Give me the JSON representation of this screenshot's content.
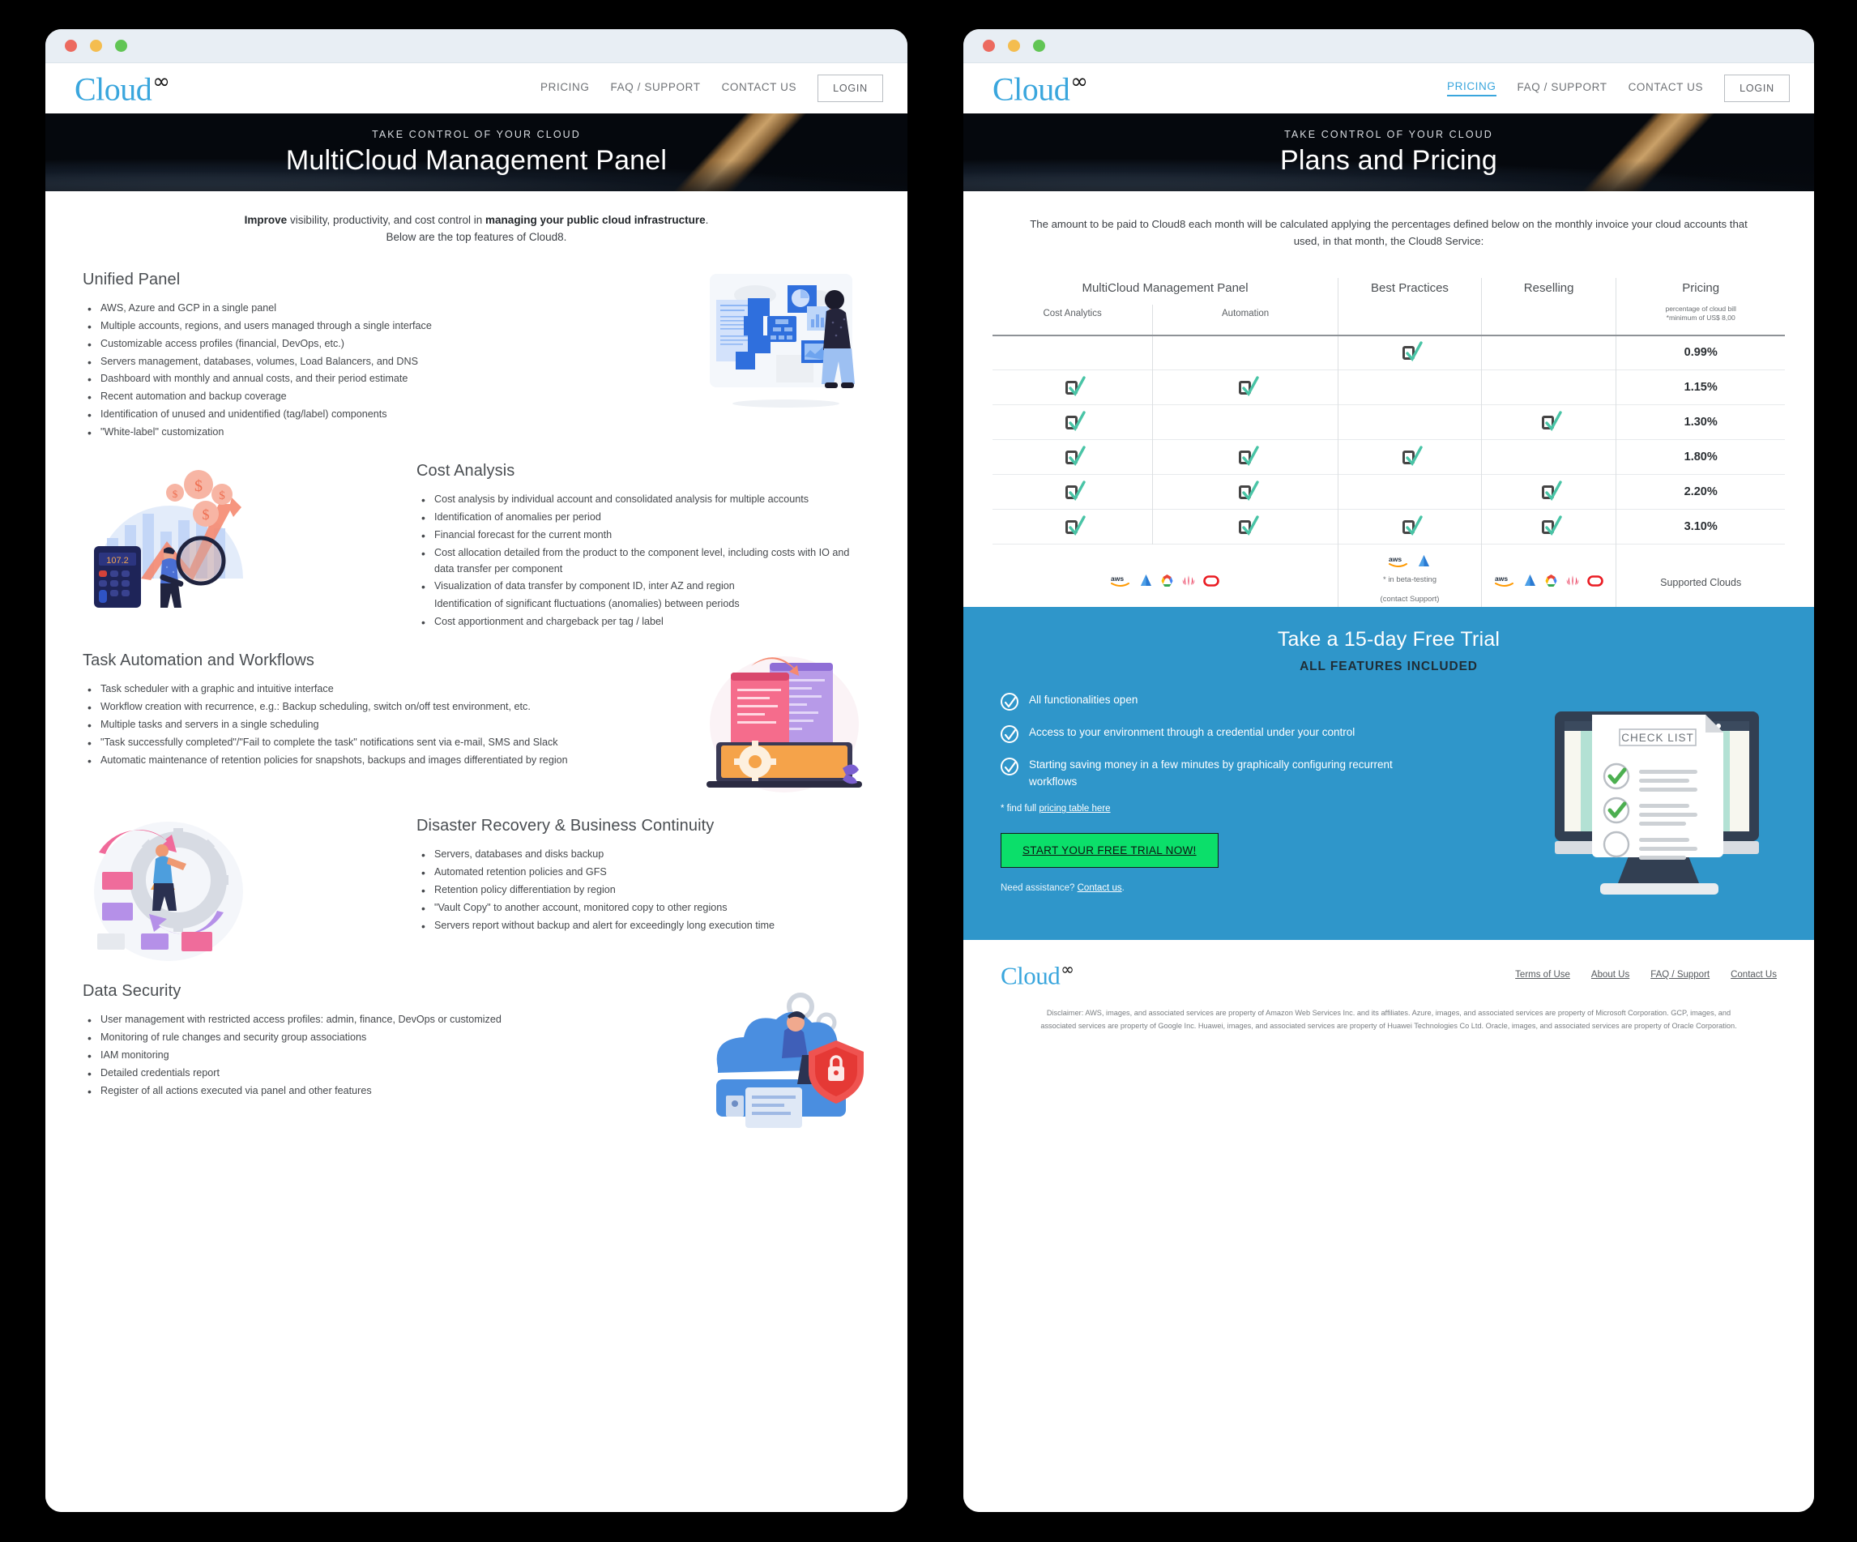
{
  "brand": {
    "name": "Cloud",
    "mark": "∞"
  },
  "window_left": {
    "nav": {
      "items": [
        "PRICING",
        "FAQ / SUPPORT",
        "CONTACT US"
      ],
      "active": null,
      "login": "LOGIN"
    },
    "hero": {
      "kicker": "TAKE CONTROL OF YOUR CLOUD",
      "title": "MultiCloud Management Panel"
    },
    "intro": {
      "line1_bold_start": "Improve",
      "line1_mid": " visibility, productivity, and cost control in ",
      "line1_bold_end": "managing your public cloud infrastructure",
      "line1_tail": ".",
      "line2": "Below are the top features of Cloud8."
    },
    "features": [
      {
        "title": "Unified Panel",
        "art": "unified-panel-illustration",
        "items": [
          "AWS, Azure and GCP in a single panel",
          "Multiple accounts, regions, and users managed through a single interface",
          "Customizable access profiles (financial, DevOps, etc.)",
          "Servers management, databases, volumes, Load Balancers, and DNS",
          "Dashboard with monthly and annual costs, and their period estimate",
          "Recent automation and backup coverage",
          "Identification of unused and unidentified (tag/label) components",
          "\"White-label\" customization"
        ]
      },
      {
        "title": "Cost Analysis",
        "art": "cost-analysis-illustration",
        "items": [
          "Cost analysis by individual account and consolidated analysis for multiple accounts",
          "Identification of anomalies per period",
          "Financial forecast for the current month",
          "Cost allocation detailed from the product to the component level, including costs with IO and data transfer per component",
          "Visualization of data transfer by component ID, inter AZ and region",
          "Identification of significant fluctuations (anomalies) between periods",
          "Cost apportionment and chargeback per tag / label"
        ],
        "no_bullet_indexes": [
          5
        ]
      },
      {
        "title": "Task Automation and Workflows",
        "art": "task-automation-illustration",
        "items": [
          "Task scheduler with a graphic and intuitive interface",
          "Workflow creation with recurrence, e.g.: Backup scheduling, switch on/off test environment, etc.",
          "Multiple tasks and servers in a single scheduling",
          "\"Task successfully completed\"/\"Fail to complete the task\" notifications sent via e-mail, SMS and Slack",
          "Automatic maintenance of retention policies for snapshots, backups and images differentiated by region"
        ]
      },
      {
        "title": "Disaster Recovery & Business Continuity",
        "art": "disaster-recovery-illustration",
        "items": [
          "Servers, databases and disks backup",
          "Automated retention policies and GFS",
          "Retention policy differentiation by region",
          "\"Vault Copy\" to another account, monitored copy to other regions",
          "Servers report without backup and alert for exceedingly long execution time"
        ]
      },
      {
        "title": "Data Security",
        "art": "data-security-illustration",
        "items": [
          "User management with restricted access profiles: admin, finance, DevOps or customized",
          "Monitoring of rule changes and security group associations",
          "IAM monitoring",
          "Detailed credentials report",
          "Register of all actions executed via panel and other features"
        ]
      }
    ]
  },
  "window_right": {
    "nav": {
      "items": [
        "PRICING",
        "FAQ / SUPPORT",
        "CONTACT US"
      ],
      "active": "PRICING",
      "login": "LOGIN"
    },
    "hero": {
      "kicker": "TAKE CONTROL OF YOUR CLOUD",
      "title": "Plans and Pricing"
    },
    "intro": "The amount to be paid to Cloud8 each month will be calculated applying the percentages defined below on the monthly invoice your cloud accounts that used, in that month, the Cloud8 Service:",
    "table": {
      "group_headers": [
        "MultiCloud Management Panel",
        "Best Practices",
        "Reselling",
        "Pricing"
      ],
      "sub_headers": [
        "Cost Analytics",
        "Automation",
        "",
        "",
        "percentage of cloud bill\n*minimum of US$ 8,00"
      ],
      "columns": [
        "Cost Analytics",
        "Automation",
        "Best Practices",
        "Reselling",
        "Pricing"
      ],
      "rows": [
        {
          "checks": [
            false,
            false,
            true,
            false
          ],
          "price": "0.99%"
        },
        {
          "checks": [
            true,
            true,
            false,
            false
          ],
          "price": "1.15%"
        },
        {
          "checks": [
            true,
            false,
            false,
            true
          ],
          "price": "1.30%"
        },
        {
          "checks": [
            true,
            true,
            true,
            false
          ],
          "price": "1.80%"
        },
        {
          "checks": [
            true,
            true,
            false,
            true
          ],
          "price": "2.20%"
        },
        {
          "checks": [
            true,
            true,
            true,
            true
          ],
          "price": "3.10%"
        }
      ],
      "supported_row": {
        "multicloud_clouds": [
          "aws",
          "azure",
          "gcp",
          "huawei",
          "oracle"
        ],
        "best_practices_clouds": [
          "aws",
          "azure"
        ],
        "best_practices_note_1": "* in beta-testing",
        "best_practices_note_2": "(contact Support)",
        "reselling_clouds": [
          "aws",
          "azure",
          "gcp",
          "huawei",
          "oracle"
        ],
        "label": "Supported Clouds"
      }
    },
    "trial": {
      "title": "Take a 15-day Free Trial",
      "subtitle": "ALL FEATURES INCLUDED",
      "bullets": [
        "All functionalities open",
        "Access to your environment through a credential under your control",
        "Starting saving money in a few minutes by graphically configuring recurrent workflows"
      ],
      "find_full_prefix": "* find full ",
      "find_full_link": "pricing table here",
      "cta": "START YOUR FREE TRIAL NOW!",
      "assistance_prefix": "Need assistance? ",
      "assistance_link": "Contact us",
      "assistance_suffix": ".",
      "art_label": "CHECK LIST",
      "bg_color": "#2f96ca",
      "cta_color": "#0bdf6a"
    },
    "footer": {
      "links": [
        "Terms of Use",
        "About Us",
        "FAQ / Support",
        "Contact Us"
      ],
      "disclaimer": "Disclaimer: AWS, images, and associated services are property of Amazon Web Services Inc. and its affiliates. Azure, images, and associated services are property of Microsoft Corporation. GCP, images, and associated services are property of Google Inc. Huawei, images, and associated services are property of Huawei Technologies Co Ltd. Oracle, images, and associated services are property of Oracle Corporation."
    }
  }
}
